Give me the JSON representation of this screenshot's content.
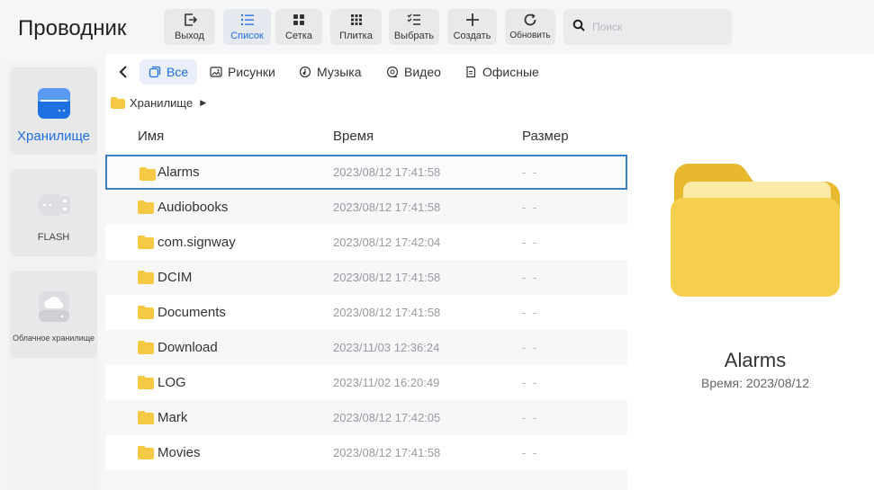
{
  "app": {
    "title": "Проводник"
  },
  "toolbar": {
    "exit": "Выход",
    "list": "Список",
    "grid": "Сетка",
    "tile": "Плитка",
    "select": "Выбрать",
    "create": "Создать",
    "refresh": "Обновить"
  },
  "search": {
    "placeholder": "Поиск",
    "value": ""
  },
  "sidebar": {
    "items": [
      {
        "label": "Хранилище",
        "icon": "storage-icon",
        "active": true
      },
      {
        "label": "FLASH",
        "icon": "usb-flash-icon",
        "active": false
      },
      {
        "label": "Облачное хранилище",
        "icon": "cloud-storage-icon",
        "active": false
      }
    ]
  },
  "filters": {
    "all": "Все",
    "pictures": "Рисунки",
    "music": "Музыка",
    "video": "Видео",
    "office": "Офисные",
    "active": "all"
  },
  "breadcrumb": {
    "path": "Хранилище"
  },
  "columns": {
    "name": "Имя",
    "time": "Время",
    "size": "Размер"
  },
  "files": [
    {
      "name": "Alarms",
      "time": "2023/08/12 17:41:58",
      "size": "- -"
    },
    {
      "name": "Audiobooks",
      "time": "2023/08/12 17:41:58",
      "size": "- -"
    },
    {
      "name": "com.signway",
      "time": "2023/08/12 17:42:04",
      "size": "- -"
    },
    {
      "name": "DCIM",
      "time": "2023/08/12 17:41:58",
      "size": "- -"
    },
    {
      "name": "Documents",
      "time": "2023/08/12 17:41:58",
      "size": "- -"
    },
    {
      "name": "Download",
      "time": "2023/11/03 12:36:24",
      "size": "- -"
    },
    {
      "name": "LOG",
      "time": "2023/11/02 16:20:49",
      "size": "- -"
    },
    {
      "name": "Mark",
      "time": "2023/08/12 17:42:05",
      "size": "- -"
    },
    {
      "name": "Movies",
      "time": "2023/08/12 17:41:58",
      "size": "- -"
    }
  ],
  "preview": {
    "name": "Alarms",
    "time": "Время: 2023/08/12"
  },
  "colors": {
    "accent": "#1e6fe0",
    "folder": "#f6c945",
    "folder_back": "#e8b82e",
    "selection_border": "#3a7fc9"
  }
}
